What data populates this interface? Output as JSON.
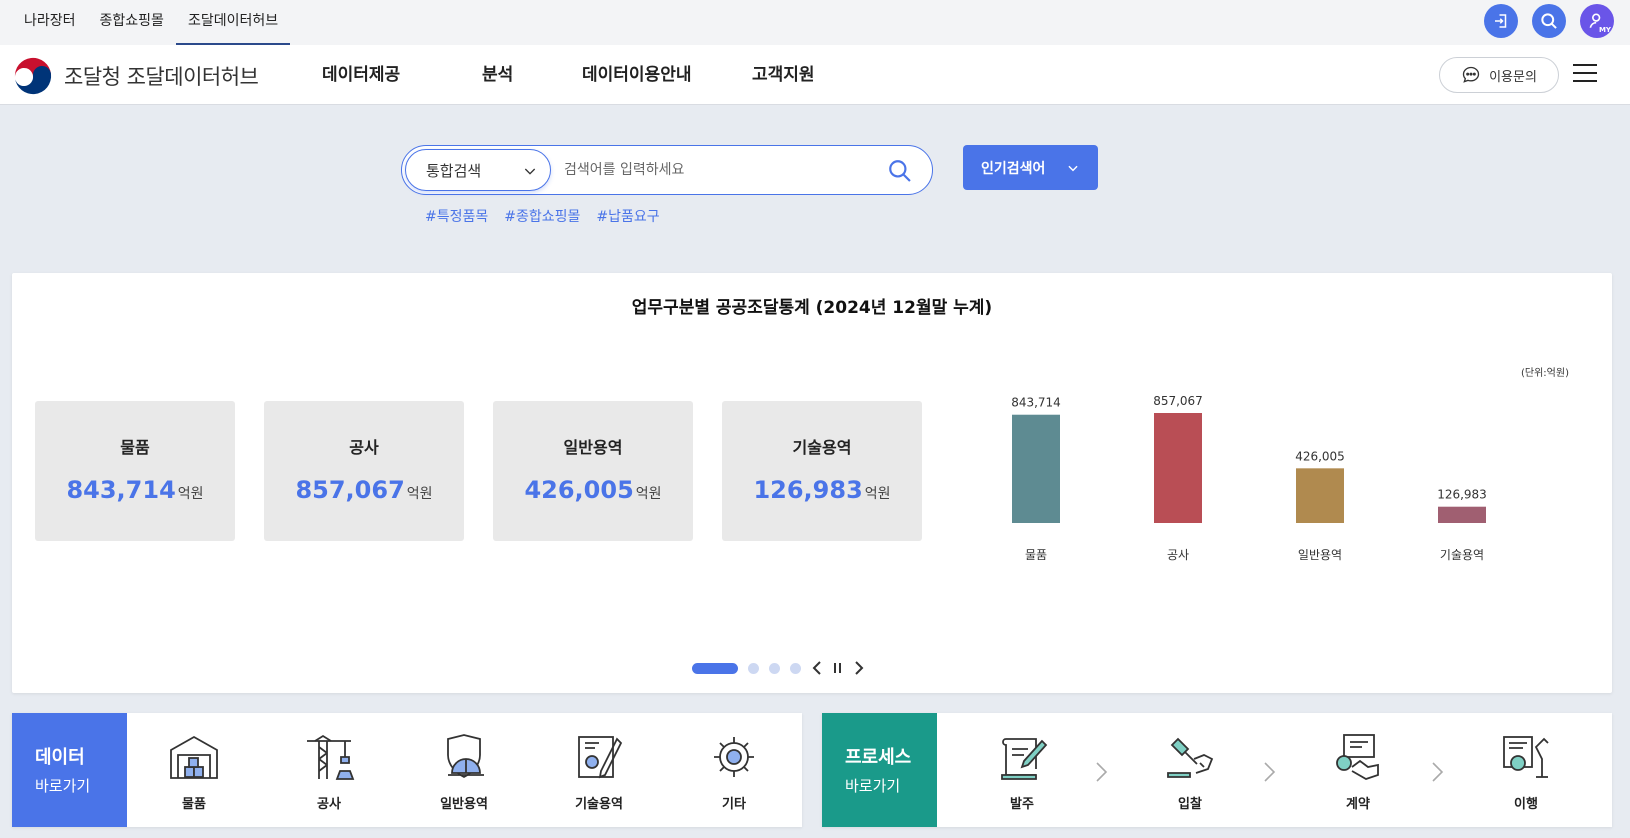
{
  "topbar": {
    "tabs": [
      "나라장터",
      "종합쇼핑몰",
      "조달데이터허브"
    ],
    "my_label": "MY"
  },
  "header": {
    "logo_text": "조달청 조달데이터허브",
    "menu": [
      "데이터제공",
      "분석",
      "데이터이용안내",
      "고객지원"
    ],
    "inquiry_label": "이용문의"
  },
  "search": {
    "category": "통합검색",
    "placeholder": "검색어를 입력하세요",
    "popular_label": "인기검색어",
    "hashtags": [
      "#특정품목",
      "#종합쇼핑몰",
      "#납품요구"
    ]
  },
  "stats": {
    "title": "업무구분별 공공조달통계 (2024년 12월말 누계)",
    "unit_label": "(단위:억원)",
    "value_unit": "억원",
    "cards": [
      {
        "label": "물품",
        "value": "843,714"
      },
      {
        "label": "공사",
        "value": "857,067"
      },
      {
        "label": "일반용역",
        "value": "426,005"
      },
      {
        "label": "기술용역",
        "value": "126,983"
      }
    ]
  },
  "chart_data": {
    "type": "bar",
    "categories": [
      "물품",
      "공사",
      "일반용역",
      "기술용역"
    ],
    "values": [
      843714,
      857067,
      426005,
      126983
    ],
    "value_labels": [
      "843,714",
      "857,067",
      "426,005",
      "126,983"
    ],
    "colors": [
      "#5e8b92",
      "#b94e55",
      "#b08a4f",
      "#a05f71"
    ],
    "title": "",
    "ylabel": "(단위:억원)",
    "grid": false
  },
  "shortcut_data": {
    "title": "데이터",
    "subtitle": "바로가기",
    "color": "#4a74e8",
    "items": [
      {
        "label": "물품",
        "icon": "warehouse-icon"
      },
      {
        "label": "공사",
        "icon": "crane-icon"
      },
      {
        "label": "일반용역",
        "icon": "helmet-shield-icon"
      },
      {
        "label": "기술용역",
        "icon": "blueprint-icon"
      },
      {
        "label": "기타",
        "icon": "gear-icon"
      }
    ]
  },
  "shortcut_process": {
    "title": "프로세스",
    "subtitle": "바로가기",
    "color": "#1a9a8a",
    "items": [
      {
        "label": "발주",
        "icon": "scroll-pen-icon"
      },
      {
        "label": "입찰",
        "icon": "gavel-hand-icon"
      },
      {
        "label": "계약",
        "icon": "handshake-contract-icon"
      },
      {
        "label": "이행",
        "icon": "robot-arm-icon"
      }
    ]
  }
}
